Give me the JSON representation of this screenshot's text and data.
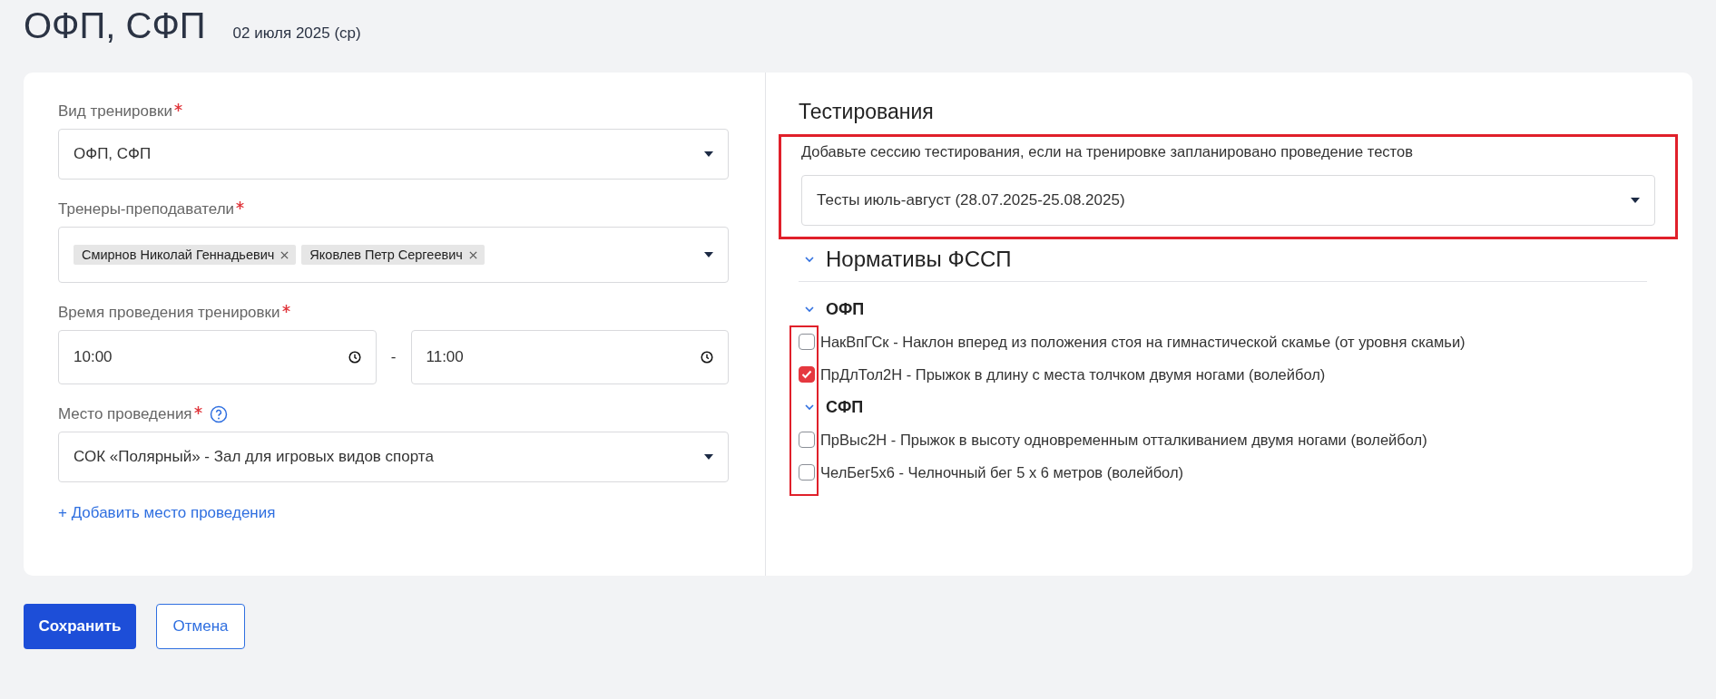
{
  "page": {
    "title": "ОФП, СФП",
    "date": "02 июля 2025 (ср)"
  },
  "form": {
    "fields": [
      {
        "kind": "select",
        "label": "Вид тренировки",
        "required": true,
        "value": "ОФП, СФП"
      },
      {
        "kind": "tags",
        "label": "Тренеры-преподаватели",
        "required": true,
        "tags": [
          "Смирнов Николай Геннадьевич",
          "Яковлев Петр Сергеевич"
        ]
      },
      {
        "kind": "time_range",
        "label": "Время проведения тренировки",
        "required": true,
        "from": "10:00",
        "separator": "-",
        "to": "11:00"
      },
      {
        "kind": "select",
        "label": "Место проведения",
        "required": true,
        "help": true,
        "value": "СОК «Полярный» - Зал для игровых видов спорта"
      }
    ],
    "add_link": "+ Добавить место проведения"
  },
  "testing": {
    "title": "Тестирования",
    "highlighted": true,
    "hint": "Добавьте сессию тестирования, если на тренировке запланировано проведение тестов",
    "session": "Тесты июль-август (28.07.2025-25.08.2025)",
    "norms": {
      "title": "Нормативы ФССП",
      "expanded": true,
      "checkboxes_highlighted": true,
      "groups": [
        {
          "title": "ОФП",
          "expanded": true,
          "items": [
            {
              "label": "НакВпГСк - Наклон вперед из положения стоя на гимнастической скамье (от уровня скамьи)",
              "checked": false
            },
            {
              "label": "ПрДлТол2Н - Прыжок в длину с места толчком двумя ногами (волейбол)",
              "checked": true
            }
          ]
        },
        {
          "title": "СФП",
          "expanded": true,
          "items": [
            {
              "label": "ПрВыс2Н - Прыжок в высоту одновременным отталкиванием двумя ногами (волейбол)",
              "checked": false
            },
            {
              "label": "ЧелБег5х6 - Челночный бег 5 х 6 метров (волейбол)",
              "checked": false
            }
          ]
        }
      ]
    }
  },
  "buttons": [
    {
      "label": "Сохранить",
      "kind": "primary"
    },
    {
      "label": "Отмена",
      "kind": "outline"
    }
  ]
}
